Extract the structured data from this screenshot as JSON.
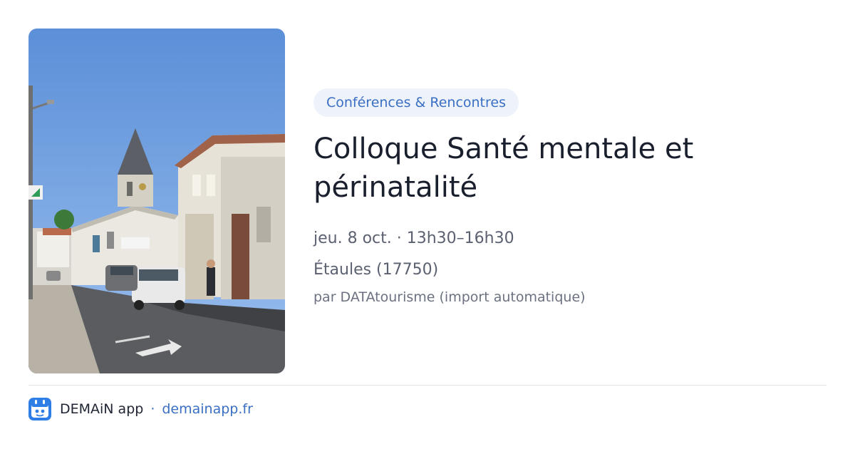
{
  "event": {
    "category": "Conférences & Rencontres",
    "title": "Colloque Santé mentale et périnatalité",
    "datetime": "jeu. 8 oct. · 13h30–16h30",
    "location": "Étaules (17750)",
    "source": "par DATAtourisme (import automatique)",
    "image": "photo of a village street with church bell tower, houses and parked cars"
  },
  "footer": {
    "app_name": "DEMAiN app",
    "separator": "·",
    "link": "demainapp.fr",
    "icon": "demain-app-icon"
  },
  "colors": {
    "accent": "#3a6fc4",
    "badge_bg": "#eef3fb",
    "title": "#1a1f2e",
    "divider": "#dfe3e9"
  }
}
